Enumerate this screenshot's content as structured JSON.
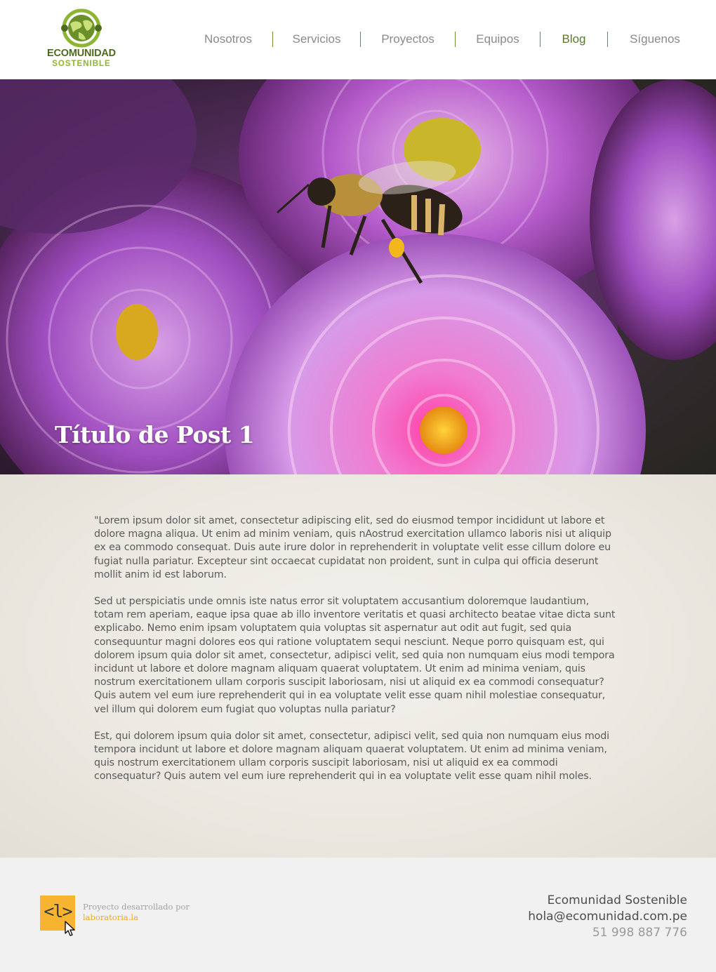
{
  "brand": {
    "name": "ECOMUNIDAD",
    "tagline": "SOSTENIBLE",
    "primary_color": "#5a7a2b",
    "accent_color": "#8db531"
  },
  "nav": {
    "items": [
      {
        "label": "Nosotros",
        "active": false
      },
      {
        "label": "Servicios",
        "active": false
      },
      {
        "label": "Proyectos",
        "active": false
      },
      {
        "label": "Equipos",
        "active": false
      },
      {
        "label": "Blog",
        "active": true
      },
      {
        "label": "Síguenos",
        "active": false
      }
    ]
  },
  "hero": {
    "image": "bee-on-purple-dahlias-photo",
    "title": "Título de Post 1"
  },
  "article": {
    "paragraphs": [
      "\"Lorem ipsum dolor sit amet, consectetur adipiscing elit, sed do eiusmod tempor incididunt ut labore et dolore magna aliqua. Ut enim ad minim veniam, quis nAostrud exercitation ullamco laboris nisi ut aliquip ex ea commodo consequat. Duis aute irure dolor in reprehenderit in voluptate velit esse cillum dolore eu fugiat nulla pariatur. Excepteur sint occaecat cupidatat non proident, sunt in culpa qui officia deserunt mollit anim id est laborum.",
      "Sed ut perspiciatis unde omnis iste natus error sit voluptatem accusantium doloremque laudantium, totam rem aperiam, eaque ipsa quae ab illo inventore veritatis et quasi architecto beatae vitae dicta sunt explicabo. Nemo enim ipsam voluptatem quia voluptas sit aspernatur aut odit aut fugit, sed quia consequuntur magni dolores eos qui ratione voluptatem sequi nesciunt. Neque porro quisquam est, qui dolorem ipsum quia dolor sit amet, consectetur, adipisci velit, sed quia non numquam eius modi tempora incidunt ut labore et dolore magnam aliquam quaerat voluptatem. Ut enim ad minima veniam, quis nostrum exercitationem ullam corporis suscipit laboriosam, nisi ut aliquid ex ea commodi consequatur? Quis autem vel eum iure reprehenderit qui in ea voluptate velit esse quam nihil molestiae consequatur, vel illum qui dolorem eum fugiat quo voluptas nulla pariatur?",
      "Est, qui dolorem ipsum quia dolor sit amet, consectetur, adipisci velit, sed quia non numquam eius modi tempora incidunt ut labore et dolore magnam aliquam quaerat voluptatem. Ut enim ad minima veniam, quis nostrum exercitationem ullam corporis suscipit laboriosam, nisi ut aliquid ex ea commodi consequatur? Quis autem vel eum iure reprehenderit qui in ea voluptate velit esse quam nihil moles."
    ]
  },
  "footer": {
    "lab_logo_text": "<l>",
    "credit_label": "Proyecto desarrollado por",
    "credit_link": "laboratoria.la",
    "contact": {
      "name": "Ecomunidad Sostenible",
      "email": "hola@ecomunidad.com.pe",
      "phone": "51 998 887 776"
    },
    "accent_color": "#f7b430"
  }
}
